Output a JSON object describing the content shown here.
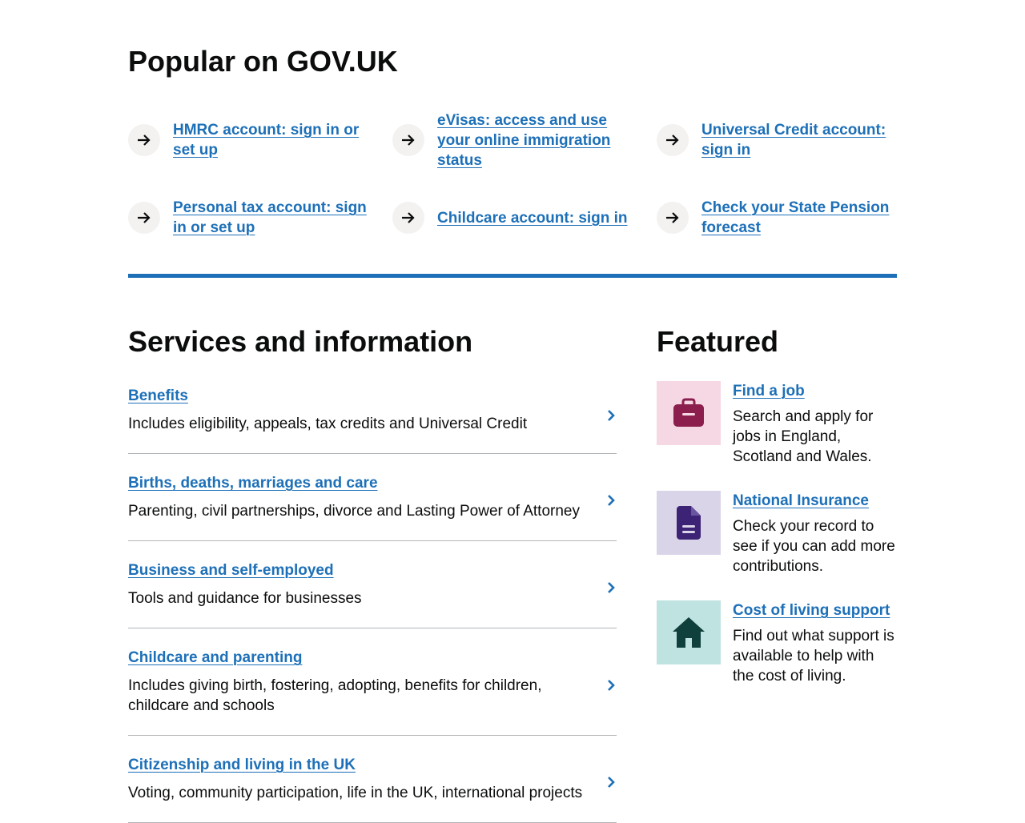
{
  "popular": {
    "title": "Popular on GOV.UK",
    "items": [
      {
        "label": "HMRC account: sign in or set up"
      },
      {
        "label": "eVisas: access and use your online immigration status"
      },
      {
        "label": "Universal Credit account: sign in"
      },
      {
        "label": "Personal tax account: sign in or set up"
      },
      {
        "label": "Childcare account: sign in"
      },
      {
        "label": "Check your State Pension forecast"
      }
    ]
  },
  "services": {
    "title": "Services and information",
    "items": [
      {
        "label": "Benefits",
        "description": "Includes eligibility, appeals, tax credits and Universal Credit"
      },
      {
        "label": "Births, deaths, marriages and care",
        "description": "Parenting, civil partnerships, divorce and Lasting Power of Attorney"
      },
      {
        "label": "Business and self-employed",
        "description": "Tools and guidance for businesses"
      },
      {
        "label": "Childcare and parenting",
        "description": "Includes giving birth, fostering, adopting, benefits for children, childcare and schools"
      },
      {
        "label": "Citizenship and living in the UK",
        "description": "Voting, community participation, life in the UK, international projects"
      }
    ]
  },
  "featured": {
    "title": "Featured",
    "items": [
      {
        "label": "Find a job",
        "description": "Search and apply for jobs in England, Scotland and Wales.",
        "icon": "briefcase-icon",
        "bg": "#f6d7e4",
        "fg": "#8b1e4c"
      },
      {
        "label": "National Insurance",
        "description": "Check your record to see if you can add more contributions.",
        "icon": "document-icon",
        "bg": "#dad4e9",
        "fg": "#3d2375"
      },
      {
        "label": "Cost of living support",
        "description": "Find out what support is available to help with the cost of living.",
        "icon": "house-icon",
        "bg": "#bfe3e0",
        "fg": "#10403c"
      }
    ]
  },
  "colors": {
    "link": "#1d70b8",
    "text": "#0b0c0c",
    "divider": "#b1b4b6",
    "arrow_bg": "#f3f2f1"
  }
}
